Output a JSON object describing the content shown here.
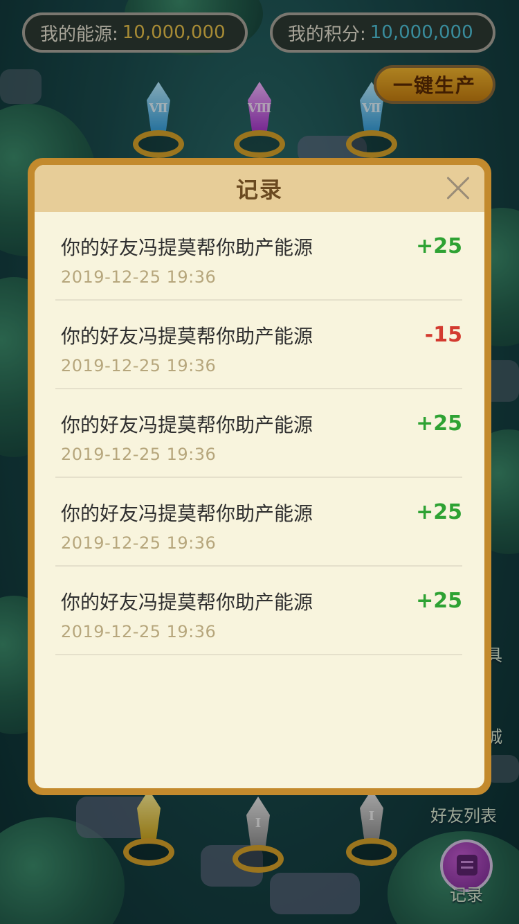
{
  "stats": {
    "energy_label": "我的能源:",
    "energy_value": "10,000,000",
    "points_label": "我的积分:",
    "points_value": "10,000,000"
  },
  "produce_button": "一键生产",
  "side": {
    "tools_label": "具",
    "mall_label": "城",
    "friends_label": "好友列表",
    "record_label": "记录"
  },
  "crystals": {
    "top_left": "Ⅶ",
    "top_mid": "Ⅷ",
    "top_right": "Ⅶ",
    "bottom_mid": "Ⅰ",
    "bottom_right": "Ⅰ"
  },
  "modal": {
    "title": "记录",
    "records": [
      {
        "text": "你的好友冯提莫帮你助产能源",
        "time": "2019-12-25   19:36",
        "amount": "+25",
        "type": "pos"
      },
      {
        "text": "你的好友冯提莫帮你助产能源",
        "time": "2019-12-25   19:36",
        "amount": "-15",
        "type": "neg"
      },
      {
        "text": "你的好友冯提莫帮你助产能源",
        "time": "2019-12-25   19:36",
        "amount": "+25",
        "type": "pos"
      },
      {
        "text": "你的好友冯提莫帮你助产能源",
        "time": "2019-12-25   19:36",
        "amount": "+25",
        "type": "pos"
      },
      {
        "text": "你的好友冯提莫帮你助产能源",
        "time": "2019-12-25   19:36",
        "amount": "+25",
        "type": "pos"
      }
    ]
  },
  "colors": {
    "positive": "#2ea233",
    "negative": "#d33a2f",
    "modal_border": "#c38a2d"
  }
}
